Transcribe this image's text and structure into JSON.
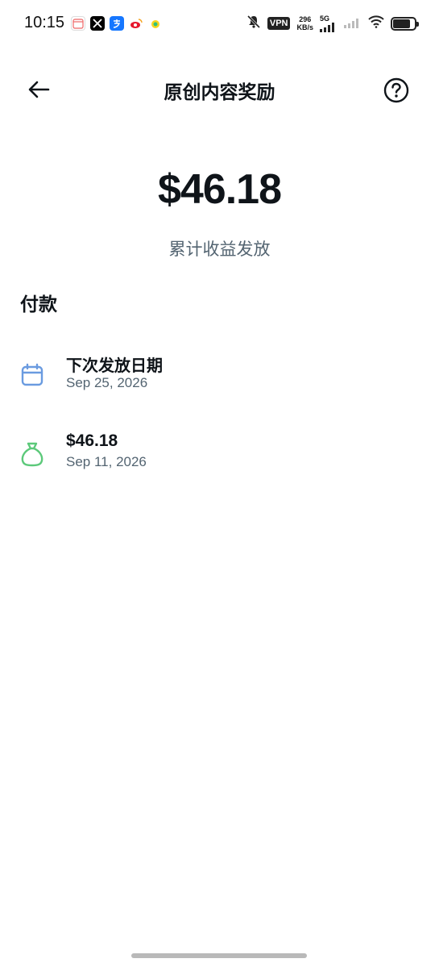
{
  "status_bar": {
    "time": "10:15",
    "vpn": "VPN",
    "speed_value": "296",
    "speed_unit": "KB/s",
    "network": "5G",
    "battery_level": 0.8
  },
  "header": {
    "title": "原创内容奖励"
  },
  "summary": {
    "amount": "$46.18",
    "label": "累计收益发放"
  },
  "payments": {
    "section_title": "付款",
    "items": [
      {
        "title": "下次发放日期",
        "date": "Sep 25, 2026",
        "icon": "calendar-icon",
        "color": "#6a9be0"
      },
      {
        "title": "$46.18",
        "date": "Sep 11, 2026",
        "icon": "money-bag-icon",
        "color": "#5cc97a"
      }
    ]
  },
  "colors": {
    "text_primary": "#0f1419",
    "text_secondary": "#536471",
    "calendar": "#6a9be0",
    "money_bag": "#5cc97a"
  }
}
